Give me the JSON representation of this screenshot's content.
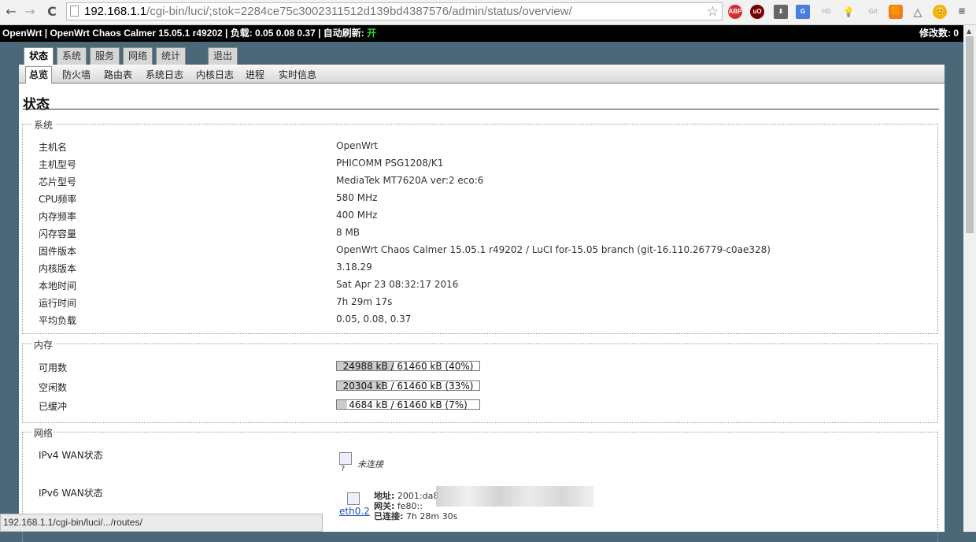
{
  "browser": {
    "url_host": "192.168.1.1",
    "url_path": "/cgi-bin/luci/;stok=2284ce75c3002311512d139bd4387576/admin/status/overview/",
    "status_url": "192.168.1.1/cgi-bin/luci/.../routes/",
    "extensions": [
      "ABP",
      "uO",
      "⬇",
      "G",
      "HD",
      "💡",
      "Gif",
      "🟧",
      "△",
      "😊",
      "≡"
    ]
  },
  "header": {
    "title": "OpenWrt | OpenWrt Chaos Calmer 15.05.1 r49202 | 负载: 0.05 0.08 0.37 | 自动刷新: ",
    "autorefresh_state": "开",
    "changes": "修改数: 0"
  },
  "main_tabs": [
    "状态",
    "系统",
    "服务",
    "网络",
    "统计",
    "退出"
  ],
  "sub_tabs": [
    "总览",
    "防火墙",
    "路由表",
    "系统日志",
    "内核日志",
    "进程",
    "实时信息"
  ],
  "page_title": "状态",
  "system": {
    "legend": "系统",
    "rows": [
      {
        "label": "主机名",
        "value": "OpenWrt"
      },
      {
        "label": "主机型号",
        "value": "PHICOMM PSG1208/K1"
      },
      {
        "label": "芯片型号",
        "value": "MediaTek MT7620A ver:2 eco:6"
      },
      {
        "label": "CPU频率",
        "value": "580 MHz"
      },
      {
        "label": "内存频率",
        "value": "400 MHz"
      },
      {
        "label": "闪存容量",
        "value": "8 MB"
      },
      {
        "label": "固件版本",
        "value": "OpenWrt Chaos Calmer 15.05.1 r49202 / LuCI for-15.05 branch (git-16.110.26779-c0ae328)"
      },
      {
        "label": "内核版本",
        "value": "3.18.29"
      },
      {
        "label": "本地时间",
        "value": "Sat Apr 23 08:32:17 2016"
      },
      {
        "label": "运行时间",
        "value": "7h 29m 17s"
      },
      {
        "label": "平均负载",
        "value": "0.05, 0.08, 0.37"
      }
    ]
  },
  "memory": {
    "legend": "内存",
    "rows": [
      {
        "label": "可用数",
        "text": "24988 kB / 61460 kB (40%)",
        "fraction": 0.4
      },
      {
        "label": "空闲数",
        "text": "20304 kB / 61460 kB (33%)",
        "fraction": 0.33
      },
      {
        "label": "已缓冲",
        "text": "4684 kB / 61460 kB (7%)",
        "fraction": 0.07
      }
    ]
  },
  "network": {
    "legend": "网络",
    "ipv4_label": "IPv4 WAN状态",
    "ipv4_icon_mark": "?",
    "ipv4_status": "未连接",
    "ipv6_label": "IPv6 WAN状态",
    "ipv6_iface": "eth0.2",
    "ipv6_addr_label": "地址:",
    "ipv6_addr": "2001:da8",
    "ipv6_gw_label": "网关:",
    "ipv6_gw": "fe80::",
    "ipv6_conn_label": "已连接:",
    "ipv6_conn": "7h 28m 30s"
  }
}
